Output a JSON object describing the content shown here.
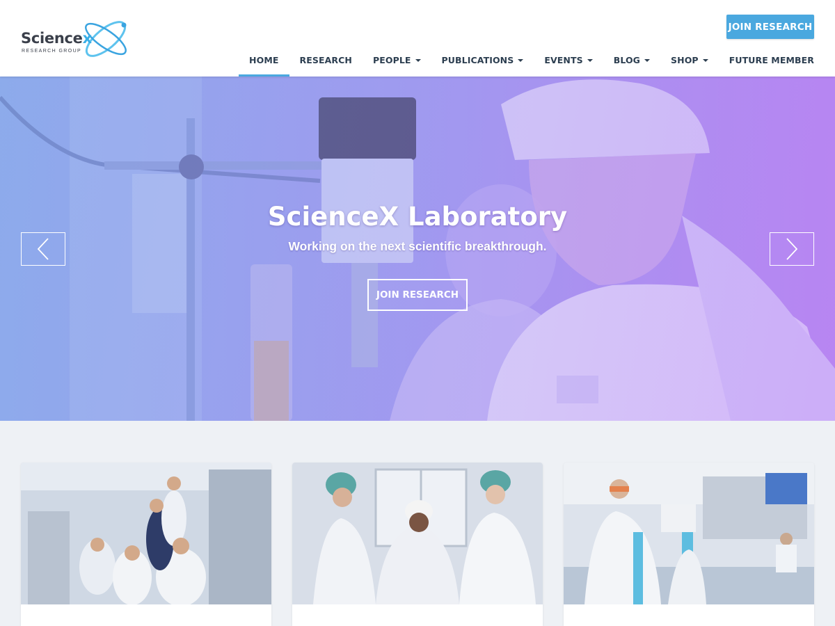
{
  "brand": {
    "name_main": "Science",
    "name_x": "x",
    "tagline": "RESEARCH GROUP",
    "accent_color": "#4aa8df",
    "logo_icon": "atom-orbit-icon"
  },
  "header": {
    "cta_label": "JOIN RESEARCH",
    "nav": [
      {
        "label": "HOME",
        "dropdown": false,
        "active": true
      },
      {
        "label": "RESEARCH",
        "dropdown": false,
        "active": false
      },
      {
        "label": "PEOPLE",
        "dropdown": true,
        "active": false
      },
      {
        "label": "PUBLICATIONS",
        "dropdown": true,
        "active": false
      },
      {
        "label": "EVENTS",
        "dropdown": true,
        "active": false
      },
      {
        "label": "BLOG",
        "dropdown": true,
        "active": false
      },
      {
        "label": "SHOP",
        "dropdown": true,
        "active": false
      },
      {
        "label": "FUTURE MEMBER",
        "dropdown": false,
        "active": false
      }
    ]
  },
  "hero": {
    "title": "ScienceX Laboratory",
    "subtitle": "Working on the next scientific breakthrough.",
    "button_label": "JOIN RESEARCH",
    "prev_icon": "chevron-left-icon",
    "next_icon": "chevron-right-icon",
    "overlay_colors": [
      "#8fa9e8",
      "#b48ff2"
    ]
  },
  "cards": [
    {
      "image": "research-team-photo"
    },
    {
      "image": "lab-staff-photo"
    },
    {
      "image": "lab-researcher-photo"
    }
  ]
}
